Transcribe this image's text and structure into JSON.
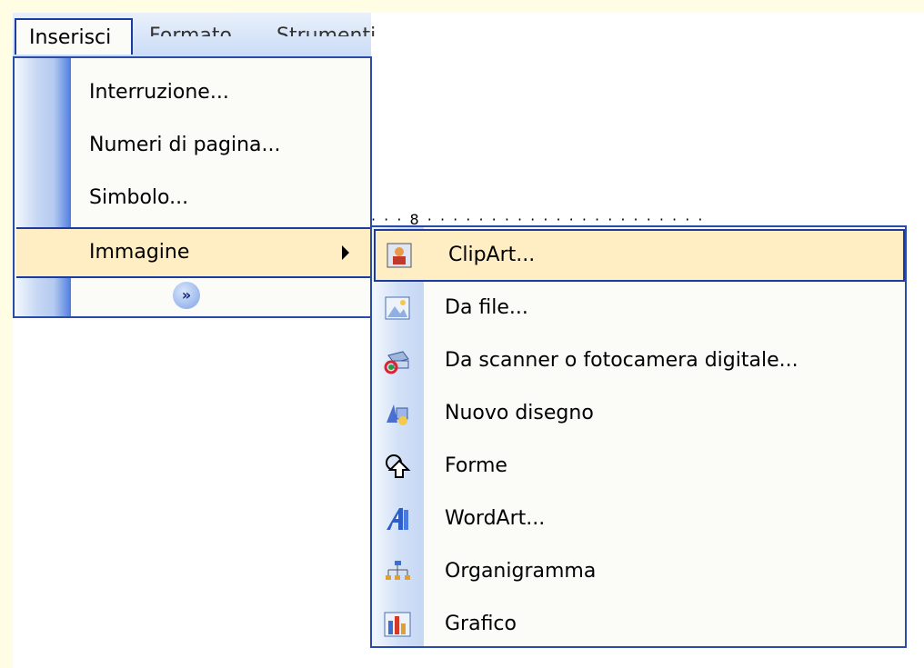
{
  "menubar": {
    "items": [
      "Inserisci",
      "Formato",
      "Strumenti"
    ]
  },
  "insert_menu": {
    "items": [
      {
        "label": "Interruzione..."
      },
      {
        "label": "Numeri di pagina..."
      },
      {
        "label": "Simbolo..."
      },
      {
        "label": "Immagine"
      }
    ],
    "expand_glyph": "»"
  },
  "ruler": {
    "text": "· · · 8 · · · · · · · · · · · · · · · · · · · · · ·"
  },
  "picture_submenu": {
    "items": [
      {
        "label": "ClipArt...",
        "icon": "clipart-icon"
      },
      {
        "label": "Da file...",
        "icon": "picture-file-icon"
      },
      {
        "label": "Da scanner o fotocamera digitale...",
        "icon": "scanner-icon"
      },
      {
        "label": "Nuovo disegno",
        "icon": "drawing-icon"
      },
      {
        "label": "Forme",
        "icon": "autoshapes-icon"
      },
      {
        "label": "WordArt...",
        "icon": "wordart-icon"
      },
      {
        "label": "Organigramma",
        "icon": "org-chart-icon"
      },
      {
        "label": "Grafico",
        "icon": "chart-icon"
      }
    ]
  },
  "colors": {
    "highlight": "#ffedc3",
    "border": "#1b3b9e",
    "background": "#fffde4"
  }
}
